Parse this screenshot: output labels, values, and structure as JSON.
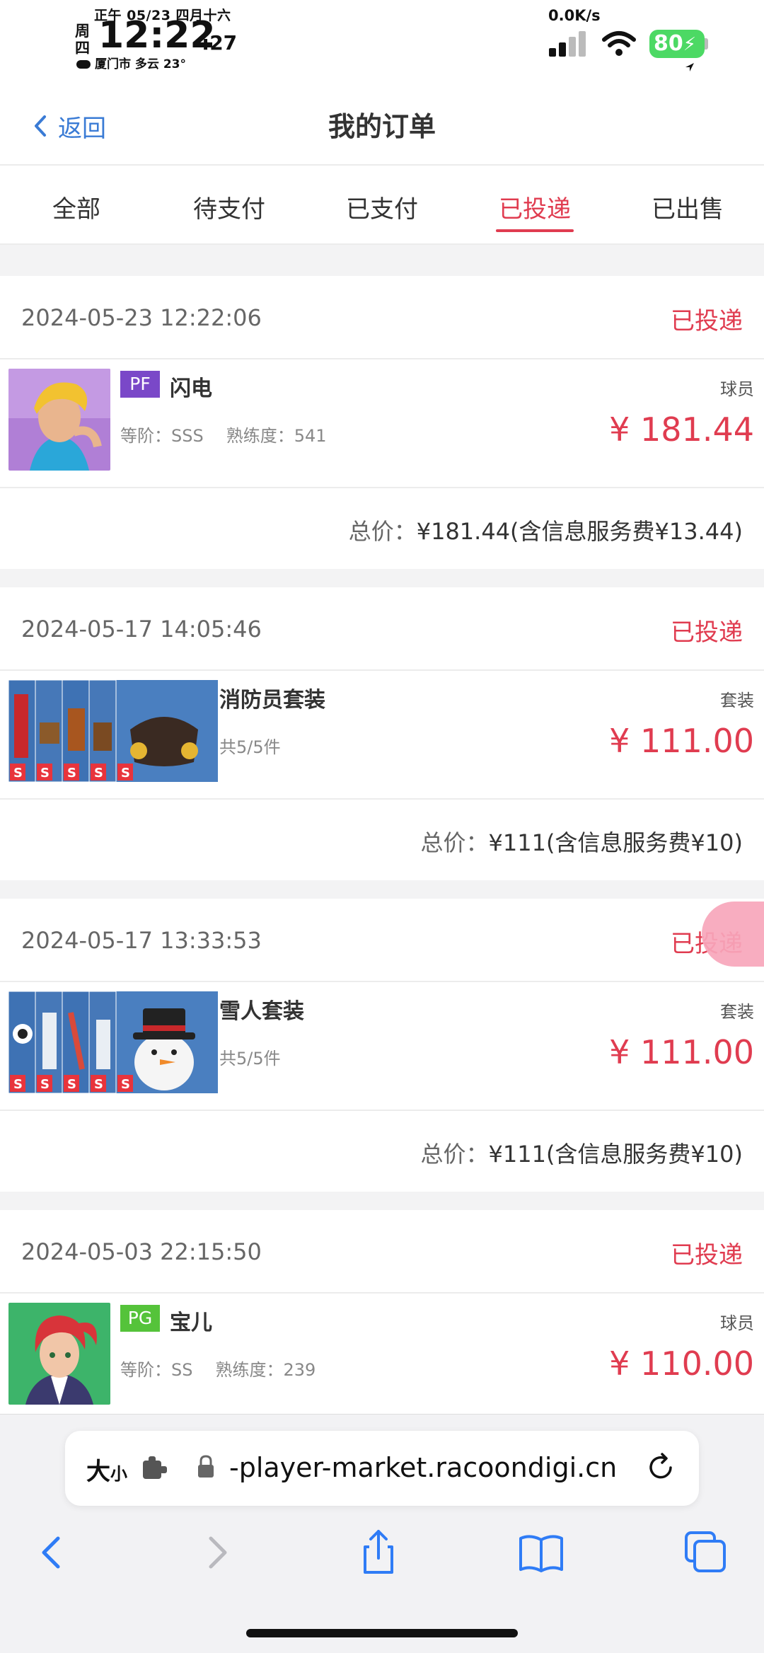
{
  "status_bar": {
    "lunar_date": "正午 05/23 四月十六",
    "weekday": "周四",
    "time": "12:22",
    "seconds": ":27",
    "weather": "厦门市 多云 23°",
    "net_speed": "0.0K/s",
    "battery": "80"
  },
  "header": {
    "back_label": "返回",
    "title": "我的订单"
  },
  "tabs": [
    {
      "label": "全部",
      "active": false
    },
    {
      "label": "待支付",
      "active": false
    },
    {
      "label": "已支付",
      "active": false
    },
    {
      "label": "已投递",
      "active": true
    },
    {
      "label": "已出售",
      "active": false
    }
  ],
  "orders": [
    {
      "date": "2024-05-23 12:22:06",
      "status": "已投递",
      "position": "PF",
      "position_color": "#7a48c8",
      "name": "闪电",
      "type": "球员",
      "grade": "等阶：SSS",
      "proficiency": "熟练度：541",
      "price": "¥ 181.44",
      "total_label": "总价：",
      "total_value": "¥181.44(含信息服务费¥13.44)"
    },
    {
      "date": "2024-05-17 14:05:46",
      "status": "已投递",
      "name": "消防员套装",
      "type": "套装",
      "count": "共5/5件",
      "price": "¥ 111.00",
      "total_label": "总价：",
      "total_value": "¥111(含信息服务费¥10)"
    },
    {
      "date": "2024-05-17 13:33:53",
      "status": "已投递",
      "name": "雪人套装",
      "type": "套装",
      "count": "共5/5件",
      "price": "¥ 111.00",
      "total_label": "总价：",
      "total_value": "¥111(含信息服务费¥10)"
    },
    {
      "date": "2024-05-03 22:15:50",
      "status": "已投递",
      "position": "PG",
      "position_color": "#55c33a",
      "name": "宝儿",
      "type": "球员",
      "grade": "等阶：SS",
      "proficiency": "熟练度：239",
      "price": "¥ 110.00"
    }
  ],
  "browser": {
    "text_size_label": "大",
    "text_size_small": "小",
    "url": "-player-market.racoondigi.cn"
  },
  "colors": {
    "accent": "#e03c50",
    "link": "#3a7bd5",
    "ios_blue": "#2f7cf6"
  }
}
